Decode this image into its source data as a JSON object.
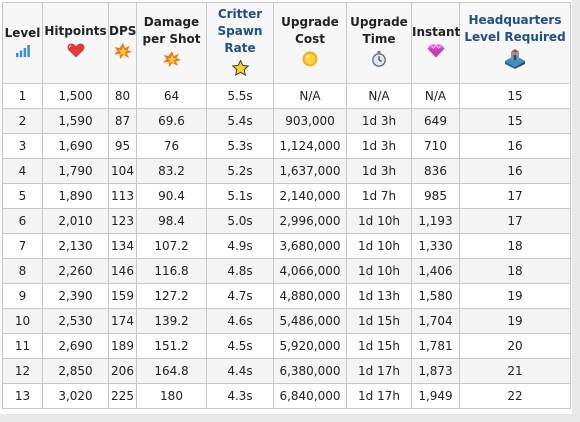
{
  "table": {
    "headers": [
      {
        "label": "Level",
        "icon": "signal-bars-icon"
      },
      {
        "label": "Hitpoints",
        "icon": "heart-icon"
      },
      {
        "label": "DPS",
        "icon": "explosion-icon"
      },
      {
        "label": "Damage per Shot",
        "icon": "explosion-icon"
      },
      {
        "label": "Critter Spawn Rate",
        "icon": "star-icon"
      },
      {
        "label": "Upgrade Cost",
        "icon": "gold-coin-icon"
      },
      {
        "label": "Upgrade Time",
        "icon": "stopwatch-icon"
      },
      {
        "label": "Instant",
        "icon": "gem-icon"
      },
      {
        "label": "Headquarters Level Required",
        "icon": "headquarters-icon"
      }
    ],
    "rows": [
      [
        "1",
        "1,500",
        "80",
        "64",
        "5.5s",
        "N/A",
        "N/A",
        "N/A",
        "15"
      ],
      [
        "2",
        "1,590",
        "87",
        "69.6",
        "5.4s",
        "903,000",
        "1d 3h",
        "649",
        "15"
      ],
      [
        "3",
        "1,690",
        "95",
        "76",
        "5.3s",
        "1,124,000",
        "1d 3h",
        "710",
        "16"
      ],
      [
        "4",
        "1,790",
        "104",
        "83.2",
        "5.2s",
        "1,637,000",
        "1d 3h",
        "836",
        "16"
      ],
      [
        "5",
        "1,890",
        "113",
        "90.4",
        "5.1s",
        "2,140,000",
        "1d 7h",
        "985",
        "17"
      ],
      [
        "6",
        "2,010",
        "123",
        "98.4",
        "5.0s",
        "2,996,000",
        "1d 10h",
        "1,193",
        "17"
      ],
      [
        "7",
        "2,130",
        "134",
        "107.2",
        "4.9s",
        "3,680,000",
        "1d 10h",
        "1,330",
        "18"
      ],
      [
        "8",
        "2,260",
        "146",
        "116.8",
        "4.8s",
        "4,066,000",
        "1d 10h",
        "1,406",
        "18"
      ],
      [
        "9",
        "2,390",
        "159",
        "127.2",
        "4.7s",
        "4,880,000",
        "1d 13h",
        "1,580",
        "19"
      ],
      [
        "10",
        "2,530",
        "174",
        "139.2",
        "4.6s",
        "5,486,000",
        "1d 15h",
        "1,704",
        "19"
      ],
      [
        "11",
        "2,690",
        "189",
        "151.2",
        "4.5s",
        "5,920,000",
        "1d 15h",
        "1,781",
        "20"
      ],
      [
        "12",
        "2,850",
        "206",
        "164.8",
        "4.4s",
        "6,380,000",
        "1d 17h",
        "1,873",
        "21"
      ],
      [
        "13",
        "3,020",
        "225",
        "180",
        "4.3s",
        "6,840,000",
        "1d 17h",
        "1,949",
        "22"
      ]
    ]
  },
  "colors": {
    "link": "#1f4f8a",
    "header_bg": "#f7f7f7",
    "stripe": "#f4f4f4",
    "border": "#c8c8c8"
  }
}
